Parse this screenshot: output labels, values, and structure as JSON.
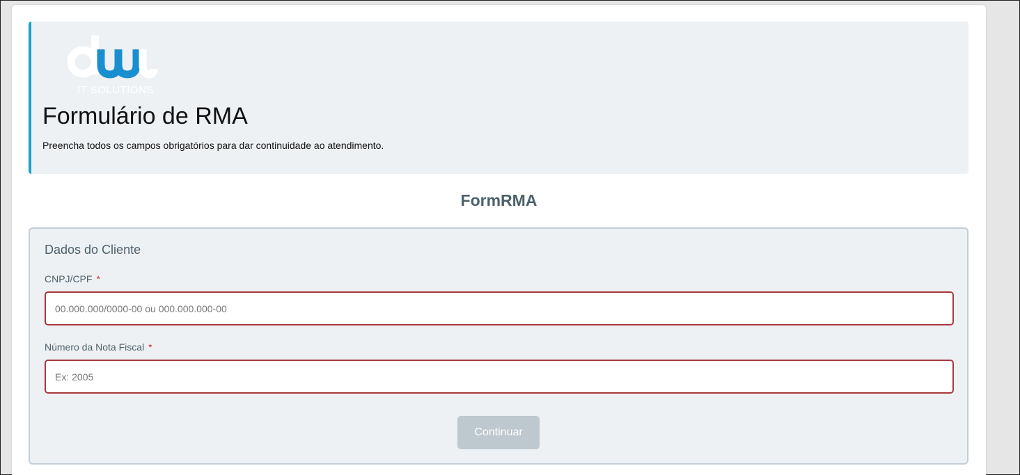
{
  "header": {
    "logo_subtitle": "IT SOLUTIONS",
    "title": "Formulário de RMA",
    "subtitle": "Preencha todos os campos obrigatórios para dar continuidade ao atendimento."
  },
  "form": {
    "name": "FormRMA",
    "section_title": "Dados do Cliente",
    "fields": [
      {
        "label": "CNPJ/CPF",
        "required_mark": "*",
        "value": "",
        "placeholder": "00.000.000/0000-00 ou 000.000.000-00"
      },
      {
        "label": "Número da Nota Fiscal",
        "required_mark": "*",
        "value": "",
        "placeholder": "Ex: 2005"
      }
    ],
    "submit_label": "Continuar"
  },
  "colors": {
    "accent": "#1aa3c9",
    "logo_blue": "#1a8fd0",
    "error_border": "#a8383c",
    "required_mark": "#cc3333",
    "button_disabled": "#bdc8cf",
    "panel_bg": "#eef1f4",
    "text_muted": "#4c616b"
  }
}
